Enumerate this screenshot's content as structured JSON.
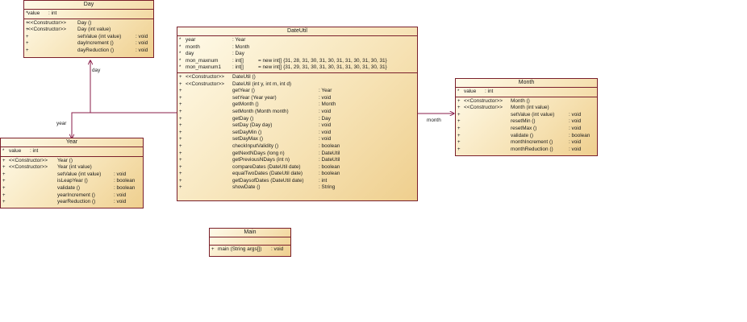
{
  "classes": {
    "day": {
      "name": "Day",
      "attributes": [
        {
          "vis": "*",
          "name": "value",
          "type": ": int"
        }
      ],
      "methods": [
        {
          "vis": "+",
          "stereo": "<<Constructor>>",
          "name": "Day ()",
          "type": ""
        },
        {
          "vis": "+",
          "stereo": "<<Constructor>>",
          "name": "Day (int value)",
          "type": ""
        },
        {
          "vis": "+",
          "stereo": "",
          "name": "setValue (int value)",
          "type": ": void"
        },
        {
          "vis": "+",
          "stereo": "",
          "name": "dayIncrement ()",
          "type": ": void"
        },
        {
          "vis": "+",
          "stereo": "",
          "name": "dayReduction ()",
          "type": ": void"
        }
      ]
    },
    "dateutil": {
      "name": "DateUtil",
      "attributes": [
        {
          "vis": "*",
          "name": "year",
          "type": ": Year",
          "init": ""
        },
        {
          "vis": "*",
          "name": "month",
          "type": ": Month",
          "init": ""
        },
        {
          "vis": "*",
          "name": "day",
          "type": ": Day",
          "init": ""
        },
        {
          "vis": "*",
          "name": "mon_maxnum",
          "type": ": int[]",
          "init": "= new int[] {31, 28, 31, 30, 31, 30, 31, 31, 30, 31, 30, 31}"
        },
        {
          "vis": "*",
          "name": "mon_maxnum1",
          "type": ": int[]",
          "init": "= new int[] {31, 29, 31, 30, 31, 30, 31, 31, 30, 31, 30, 31}"
        }
      ],
      "methods": [
        {
          "vis": "+",
          "stereo": "<<Constructor>>",
          "name": "DateUtil ()",
          "type": ""
        },
        {
          "vis": "+",
          "stereo": "<<Constructor>>",
          "name": "DateUtil (int y, int m, int d)",
          "type": ""
        },
        {
          "vis": "+",
          "stereo": "",
          "name": "getYear ()",
          "type": ": Year"
        },
        {
          "vis": "+",
          "stereo": "",
          "name": "setYear (Year year)",
          "type": ": void"
        },
        {
          "vis": "+",
          "stereo": "",
          "name": "getMonth ()",
          "type": ": Month"
        },
        {
          "vis": "+",
          "stereo": "",
          "name": "setMonth (Month month)",
          "type": ": void"
        },
        {
          "vis": "+",
          "stereo": "",
          "name": "getDay ()",
          "type": ": Day"
        },
        {
          "vis": "+",
          "stereo": "",
          "name": "setDay (Day day)",
          "type": ": void"
        },
        {
          "vis": "+",
          "stereo": "",
          "name": "setDayMin ()",
          "type": ": void"
        },
        {
          "vis": "+",
          "stereo": "",
          "name": "setDayMax ()",
          "type": ": void"
        },
        {
          "vis": "+",
          "stereo": "",
          "name": "checkInputValidity ()",
          "type": ": boolean"
        },
        {
          "vis": "+",
          "stereo": "",
          "name": "getNextNDays (long n)",
          "type": ": DateUtil"
        },
        {
          "vis": "+",
          "stereo": "",
          "name": "getPreviousNDays (int n)",
          "type": ": DateUtil"
        },
        {
          "vis": "+",
          "stereo": "",
          "name": "compareDates (DateUtil date)",
          "type": ": boolean"
        },
        {
          "vis": "+",
          "stereo": "",
          "name": "equalTwoDates (DateUtil date)",
          "type": ": boolean"
        },
        {
          "vis": "+",
          "stereo": "",
          "name": "getDaysofDates (DateUtil date)",
          "type": ": int"
        },
        {
          "vis": "+",
          "stereo": "",
          "name": "showDate ()",
          "type": ": String"
        }
      ]
    },
    "month": {
      "name": "Month",
      "attributes": [
        {
          "vis": "*",
          "name": "value",
          "type": ": int"
        }
      ],
      "methods": [
        {
          "vis": "+",
          "stereo": "<<Constructor>>",
          "name": "Month ()",
          "type": ""
        },
        {
          "vis": "+",
          "stereo": "<<Constructor>>",
          "name": "Month (int value)",
          "type": ""
        },
        {
          "vis": "+",
          "stereo": "",
          "name": "setValue (int value)",
          "type": ": void"
        },
        {
          "vis": "+",
          "stereo": "",
          "name": "resetMin ()",
          "type": ": void"
        },
        {
          "vis": "+",
          "stereo": "",
          "name": "resetMax ()",
          "type": ": void"
        },
        {
          "vis": "+",
          "stereo": "",
          "name": "validate ()",
          "type": ": boolean"
        },
        {
          "vis": "+",
          "stereo": "",
          "name": "monthIncrement ()",
          "type": ": void"
        },
        {
          "vis": "+",
          "stereo": "",
          "name": "monthReduction ()",
          "type": ": void"
        }
      ]
    },
    "year": {
      "name": "Year",
      "attributes": [
        {
          "vis": "*",
          "name": "value",
          "type": ": int"
        }
      ],
      "methods": [
        {
          "vis": "+",
          "stereo": "<<Constructor>>",
          "name": "Year ()",
          "type": ""
        },
        {
          "vis": "+",
          "stereo": "<<Constructor>>",
          "name": "Year (int value)",
          "type": ""
        },
        {
          "vis": "+",
          "stereo": "",
          "name": "setValue (int value)",
          "type": ": void"
        },
        {
          "vis": "+",
          "stereo": "",
          "name": "isLeapYear ()",
          "type": ": boolean"
        },
        {
          "vis": "+",
          "stereo": "",
          "name": "validate ()",
          "type": ": boolean"
        },
        {
          "vis": "+",
          "stereo": "",
          "name": "yearIncrement ()",
          "type": ": void"
        },
        {
          "vis": "+",
          "stereo": "",
          "name": "yearReduction ()",
          "type": ": void"
        }
      ]
    },
    "main": {
      "name": "Main",
      "attributes": [],
      "methods": [
        {
          "vis": "+",
          "stereo": "",
          "name": "main (String args[])",
          "type": ": void"
        }
      ]
    }
  },
  "associations": {
    "day": "day",
    "year": "year",
    "month": "month"
  },
  "colors": {
    "border": "#7a1f2b",
    "line": "#8a1d4a",
    "fill_light": "#fffbea",
    "fill_dark": "#efcf8e"
  }
}
